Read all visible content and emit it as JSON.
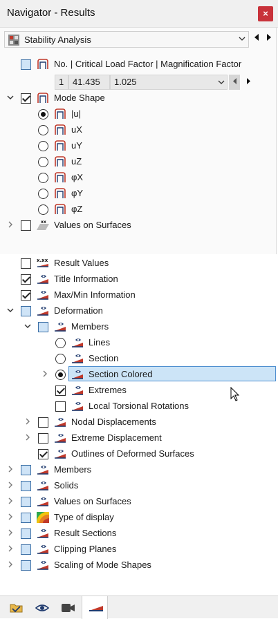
{
  "window": {
    "title": "Navigator - Results",
    "close_glyph": "×"
  },
  "analysis_selector": {
    "value": "Stability Analysis",
    "icon": "stability-analysis-icon"
  },
  "mode_table": {
    "header": "No. | Critical Load Factor | Magnification Factor",
    "no": "1",
    "critical_load_factor": "41.435",
    "magnification_factor": "1.025"
  },
  "mode_shape": {
    "label": "Mode Shape",
    "options": [
      "|u|",
      "uX",
      "uY",
      "uZ",
      "φX",
      "φY",
      "φZ"
    ],
    "selected_index": 0
  },
  "values_on_surfaces_top": "Values on Surfaces",
  "results_tree": {
    "result_values": "Result Values",
    "title_information": "Title Information",
    "maxmin_information": "Max/Min Information",
    "deformation": "Deformation",
    "members": "Members",
    "lines": "Lines",
    "section": "Section",
    "section_colored": "Section Colored",
    "extremes": "Extremes",
    "local_torsional_rotations": "Local Torsional Rotations",
    "nodal_displacements": "Nodal Displacements",
    "extreme_displacement": "Extreme Displacement",
    "outlines_deformed_surfaces": "Outlines of Deformed Surfaces",
    "members_top": "Members",
    "solids": "Solids",
    "values_on_surfaces": "Values on Surfaces",
    "type_of_display": "Type of display",
    "result_sections": "Result Sections",
    "clipping_planes": "Clipping Planes",
    "scaling_mode_shapes": "Scaling of Mode Shapes"
  },
  "colors": {
    "accent_blue": "#cce4f7",
    "close_red": "#c8323a",
    "icon_red": "#c0392b",
    "icon_navy": "#1f3a6e"
  }
}
